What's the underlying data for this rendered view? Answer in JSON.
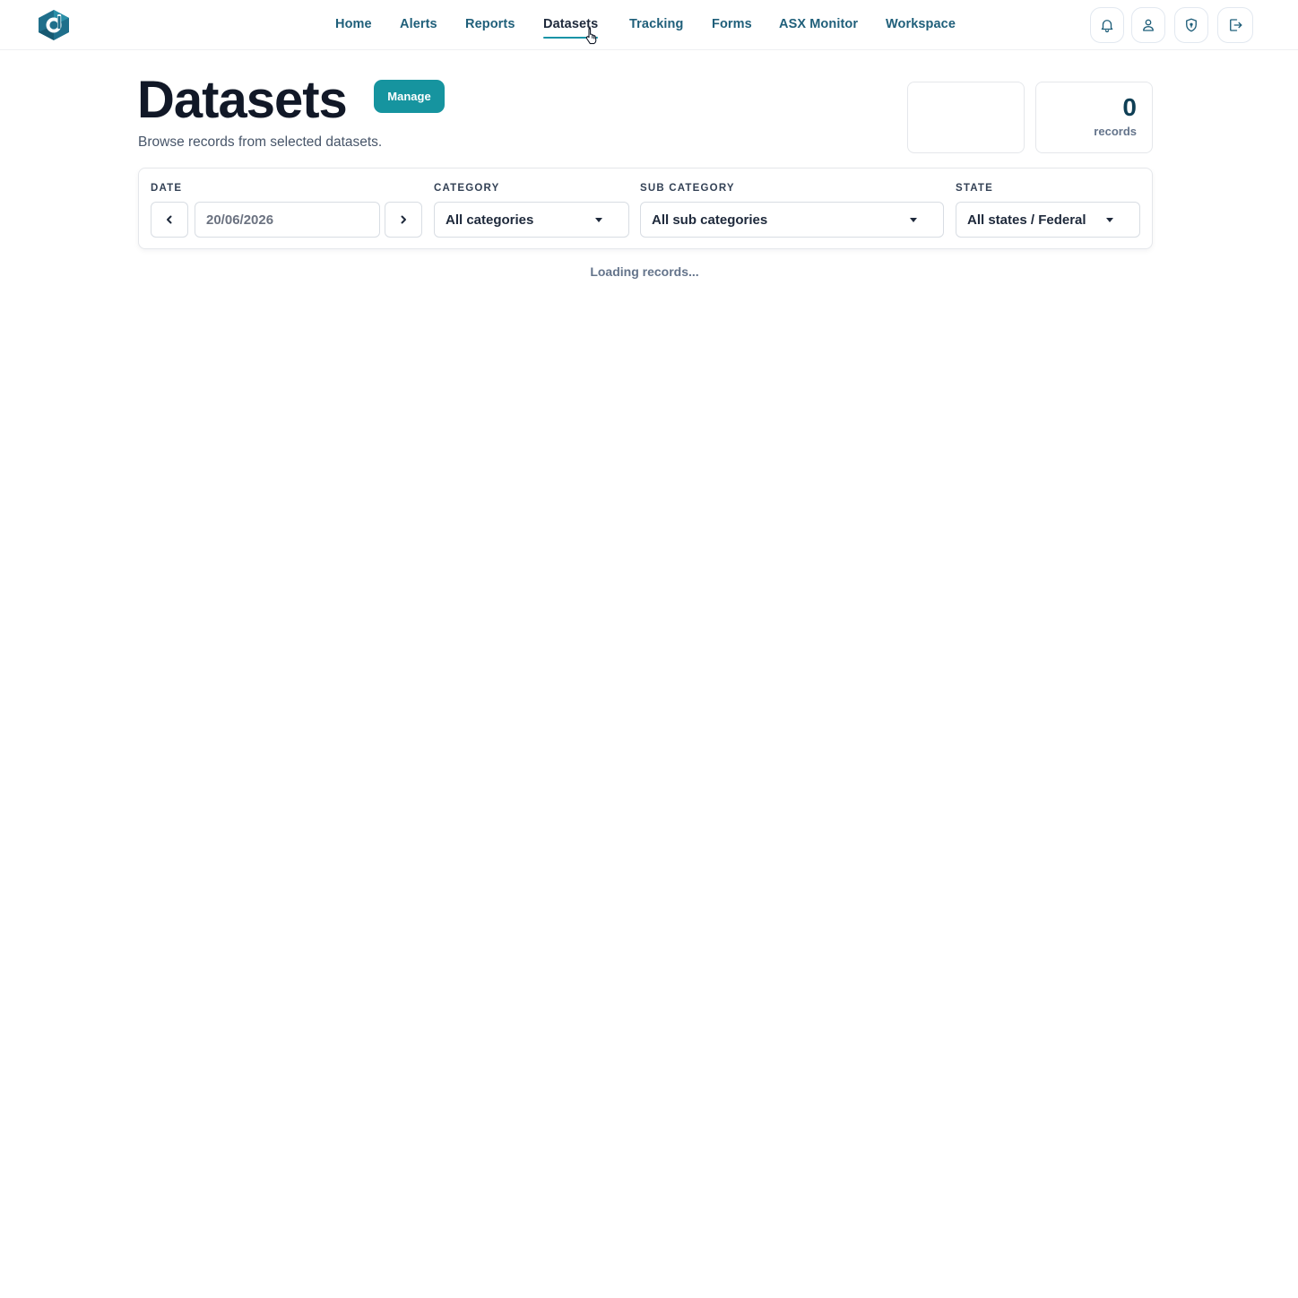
{
  "nav": {
    "items": [
      {
        "label": "Home"
      },
      {
        "label": "Alerts"
      },
      {
        "label": "Reports"
      },
      {
        "label": "Datasets",
        "active": true
      },
      {
        "label": "Tracking"
      },
      {
        "label": "Forms"
      },
      {
        "label": "ASX Monitor"
      },
      {
        "label": "Workspace"
      }
    ],
    "icons": [
      "bell-icon",
      "user-icon",
      "shield-icon",
      "logout-icon"
    ]
  },
  "header": {
    "title": "Datasets",
    "manage_label": "Manage",
    "subtitle": "Browse records from selected datasets."
  },
  "stats": {
    "empty_card": "",
    "records_value": "0",
    "records_label": "records"
  },
  "filters": {
    "date_label": "DATE",
    "date_value": "20/06/2026",
    "category_label": "CATEGORY",
    "category_value": "All categories",
    "subcategory_label": "SUB CATEGORY",
    "subcategory_value": "All sub categories",
    "state_label": "STATE",
    "state_value": "All states / Federal"
  },
  "status": {
    "loading_text": "Loading records..."
  },
  "colors": {
    "accent": "#16949f",
    "nav_text": "#1f5f7a",
    "logo": "#1f6f8b"
  }
}
